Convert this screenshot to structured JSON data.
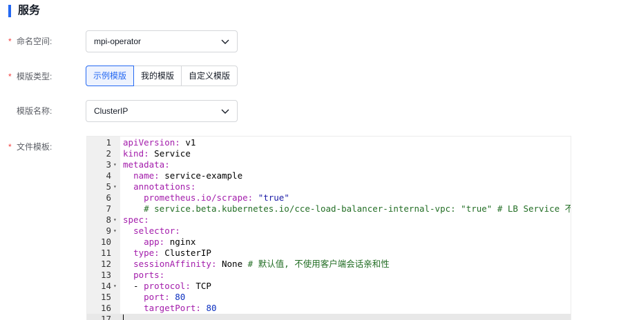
{
  "section": {
    "title": "服务"
  },
  "form": {
    "namespace": {
      "label": "命名空间:",
      "required": true,
      "value": "mpi-operator"
    },
    "template_type": {
      "label": "模版类型:",
      "required": true,
      "tabs": [
        {
          "label": "示例模版",
          "active": true
        },
        {
          "label": "我的模版",
          "active": false
        },
        {
          "label": "自定义模版",
          "active": false
        }
      ]
    },
    "template_name": {
      "label": "模版名称:",
      "required": false,
      "value": "ClusterIP"
    },
    "file_template": {
      "label": "文件模板:",
      "required": true
    }
  },
  "editor": {
    "lines": [
      {
        "num": "1",
        "fold": false,
        "html": "<span class=\"k\">apiVersion:</span> v1"
      },
      {
        "num": "2",
        "fold": false,
        "html": "<span class=\"k\">kind:</span> Service"
      },
      {
        "num": "3",
        "fold": true,
        "html": "<span class=\"k\">metadata:</span>"
      },
      {
        "num": "4",
        "fold": false,
        "html": "  <span class=\"k\">name:</span> service-example"
      },
      {
        "num": "5",
        "fold": true,
        "html": "  <span class=\"k\">annotations:</span>"
      },
      {
        "num": "6",
        "fold": false,
        "html": "    <span class=\"k\">prometheus.io/scrape:</span> <span class=\"s\">\"true\"</span>"
      },
      {
        "num": "7",
        "fold": false,
        "html": "    <span class=\"c\"># service.beta.kubernetes.io/cce-load-balancer-internal-vpc: \"true\" # LB Service 不分配</span>"
      },
      {
        "num": "8",
        "fold": true,
        "html": "<span class=\"k\">spec:</span>"
      },
      {
        "num": "9",
        "fold": true,
        "html": "  <span class=\"k\">selector:</span>"
      },
      {
        "num": "10",
        "fold": false,
        "html": "    <span class=\"k\">app:</span> nginx"
      },
      {
        "num": "11",
        "fold": false,
        "html": "  <span class=\"k\">type:</span> ClusterIP"
      },
      {
        "num": "12",
        "fold": false,
        "html": "  <span class=\"k\">sessionAffinity:</span> None <span class=\"c\"># 默认值, 不使用客户端会话亲和性</span>"
      },
      {
        "num": "13",
        "fold": false,
        "html": "  <span class=\"k\">ports:</span>"
      },
      {
        "num": "14",
        "fold": true,
        "html": "  - <span class=\"k\">protocol:</span> TCP"
      },
      {
        "num": "15",
        "fold": false,
        "html": "    <span class=\"k\">port:</span> <span class=\"n\">80</span>"
      },
      {
        "num": "16",
        "fold": false,
        "html": "    <span class=\"k\">targetPort:</span> <span class=\"n\">80</span>"
      },
      {
        "num": "17",
        "fold": false,
        "html": "",
        "cursor": true
      }
    ]
  },
  "colors": {
    "accent": "#2468f2",
    "required": "#f33e3e"
  }
}
